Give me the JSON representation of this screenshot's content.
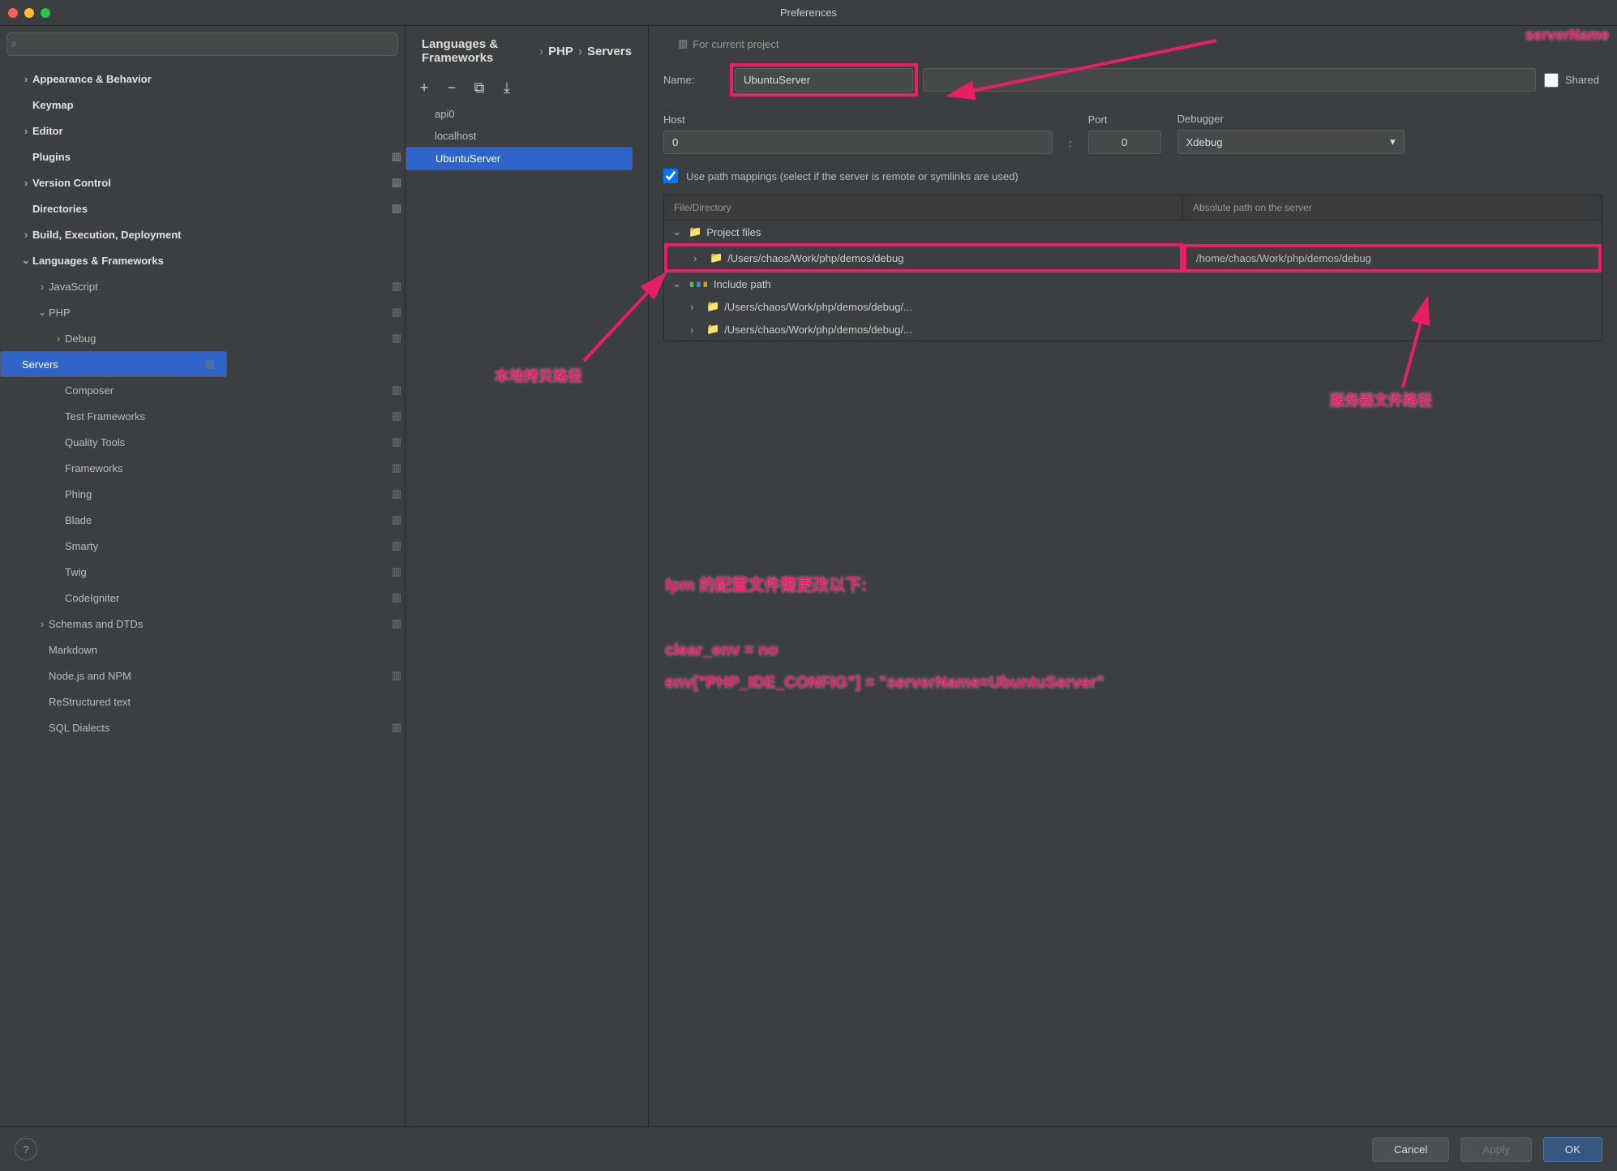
{
  "window": {
    "title": "Preferences"
  },
  "search": {
    "placeholder": ""
  },
  "nav": [
    {
      "label": "Appearance & Behavior",
      "bold": true,
      "chev": "›",
      "ind": 0
    },
    {
      "label": "Keymap",
      "bold": true,
      "ind": 0
    },
    {
      "label": "Editor",
      "bold": true,
      "chev": "›",
      "ind": 0
    },
    {
      "label": "Plugins",
      "bold": true,
      "ind": 0,
      "proj": true
    },
    {
      "label": "Version Control",
      "bold": true,
      "chev": "›",
      "ind": 0,
      "proj": true
    },
    {
      "label": "Directories",
      "bold": true,
      "ind": 0,
      "proj": true
    },
    {
      "label": "Build, Execution, Deployment",
      "bold": true,
      "chev": "›",
      "ind": 0
    },
    {
      "label": "Languages & Frameworks",
      "bold": true,
      "chev": "⌄",
      "ind": 0
    },
    {
      "label": "JavaScript",
      "chev": "›",
      "ind": 1,
      "proj": true
    },
    {
      "label": "PHP",
      "chev": "⌄",
      "ind": 1,
      "proj": true
    },
    {
      "label": "Debug",
      "chev": "›",
      "ind": 2,
      "proj": true
    },
    {
      "label": "Servers",
      "ind": 2,
      "proj": true,
      "sel": true
    },
    {
      "label": "Composer",
      "ind": 2,
      "proj": true
    },
    {
      "label": "Test Frameworks",
      "ind": 2,
      "proj": true
    },
    {
      "label": "Quality Tools",
      "ind": 2,
      "proj": true
    },
    {
      "label": "Frameworks",
      "ind": 2,
      "proj": true
    },
    {
      "label": "Phing",
      "ind": 2,
      "proj": true
    },
    {
      "label": "Blade",
      "ind": 2,
      "proj": true
    },
    {
      "label": "Smarty",
      "ind": 2,
      "proj": true
    },
    {
      "label": "Twig",
      "ind": 2,
      "proj": true
    },
    {
      "label": "CodeIgniter",
      "ind": 2,
      "proj": true
    },
    {
      "label": "Schemas and DTDs",
      "chev": "›",
      "ind": 1,
      "proj": true
    },
    {
      "label": "Markdown",
      "ind": 1
    },
    {
      "label": "Node.js and NPM",
      "ind": 1,
      "proj": true
    },
    {
      "label": "ReStructured text",
      "ind": 1
    },
    {
      "label": "SQL Dialects",
      "ind": 1,
      "proj": true
    }
  ],
  "breadcrumb": {
    "a": "Languages & Frameworks",
    "b": "PHP",
    "c": "Servers"
  },
  "mid": {
    "for_project": "For current project",
    "items": [
      "api0",
      "localhost",
      "UbuntuServer"
    ],
    "sel": 2
  },
  "form": {
    "name_label": "Name:",
    "name_value": "UbuntuServer",
    "shared_label": "Shared",
    "host_label": "Host",
    "host_value": "0",
    "port_label": "Port",
    "port_value": "0",
    "debugger_label": "Debugger",
    "debugger_value": "Xdebug",
    "pathmap_label": "Use path mappings (select if the server is remote or symlinks are used)",
    "hdr1": "File/Directory",
    "hdr2": "Absolute path on the server",
    "rows": [
      {
        "chev": "⌄",
        "icon": "folder",
        "text": "Project files",
        "abs": "",
        "ind": 0
      },
      {
        "chev": "›",
        "icon": "folder",
        "text": "/Users/chaos/Work/php/demos/debug",
        "abs": "/home/chaos/Work/php/demos/debug",
        "ind": 1,
        "box1": true,
        "box2": true
      },
      {
        "chev": "⌄",
        "icon": "bars",
        "text": "Include path",
        "abs": "",
        "ind": 0
      },
      {
        "chev": "›",
        "icon": "folder",
        "text": "/Users/chaos/Work/php/demos/debug/...",
        "abs": "",
        "ind": 1
      },
      {
        "chev": "›",
        "icon": "folder",
        "text": "/Users/chaos/Work/php/demos/debug/...",
        "abs": "",
        "ind": 1
      }
    ]
  },
  "annotations": {
    "server_name": "serverName",
    "local_path": "本地拷贝路径",
    "server_path": "服务器文件路径",
    "fpm_title": "fpm 的配置文件需更改以下:",
    "fpm_line1": "clear_env = no",
    "fpm_line2": "env[\"PHP_IDE_CONFIG\"] = \"serverName=UbuntuServer\""
  },
  "footer": {
    "cancel": "Cancel",
    "apply": "Apply",
    "ok": "OK"
  }
}
